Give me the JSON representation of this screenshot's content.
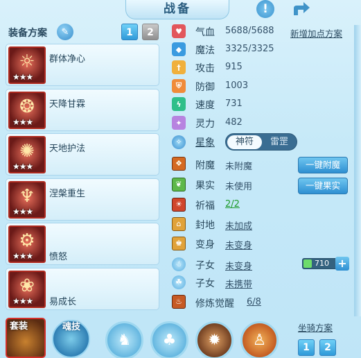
{
  "header": {
    "title": "战备"
  },
  "plan": {
    "label": "装备方案",
    "tabs": [
      "1",
      "2"
    ]
  },
  "equipment": [
    {
      "name": "群体净心",
      "stars": "★★★",
      "glyph": "☼"
    },
    {
      "name": "天降甘霖",
      "stars": "★★★",
      "glyph": "❂"
    },
    {
      "name": "天地护法",
      "stars": "★★★",
      "glyph": "✺"
    },
    {
      "name": "涅槃重生",
      "stars": "★★★",
      "glyph": "♆"
    },
    {
      "name": "愤怒",
      "stars": "★★★",
      "glyph": "⚙"
    },
    {
      "name": "易成长",
      "stars": "★★★",
      "glyph": "❀"
    }
  ],
  "stats": {
    "new_plan_link": "新增加点方案",
    "rows": [
      {
        "name": "气血",
        "value": "5688/5688",
        "icon": "heart-icon",
        "color": "#e2575c"
      },
      {
        "name": "魔法",
        "value": "3325/3325",
        "icon": "diamond-icon",
        "color": "#3a9be0"
      },
      {
        "name": "攻击",
        "value": "915",
        "icon": "sword-icon",
        "color": "#f0b03c"
      },
      {
        "name": "防御",
        "value": "1003",
        "icon": "shield-icon",
        "color": "#f08b3a"
      },
      {
        "name": "速度",
        "value": "731",
        "icon": "lightning-icon",
        "color": "#2fbf8a"
      },
      {
        "name": "灵力",
        "value": "482",
        "icon": "spirit-icon",
        "color": "#b783e0"
      }
    ]
  },
  "xingxiang": {
    "label": "星象",
    "options": [
      "神符",
      "雷罡"
    ]
  },
  "features": [
    {
      "name": "附魔",
      "value": "未附魔",
      "button": "一键附魔"
    },
    {
      "name": "果实",
      "value": "未使用",
      "button": "一键果实"
    },
    {
      "name": "祈福",
      "value": "2/2"
    },
    {
      "name": "封地",
      "value": "未加成"
    },
    {
      "name": "变身",
      "value": "未变身"
    },
    {
      "name": "子女",
      "value": "未变身"
    },
    {
      "name": "子女",
      "value": "未携带"
    },
    {
      "name": "修炼觉醒",
      "value": "6/8"
    }
  ],
  "counter": {
    "value": "710"
  },
  "bottom": {
    "suit_label": "套装",
    "skill_label": "魂技",
    "mount_label": "坐骑方案",
    "mount_tabs": [
      "1",
      "2"
    ]
  },
  "colors": {
    "accent": "#2f9ad9",
    "panel": "#d4eef9",
    "stars_frame": "#b02a1f"
  }
}
